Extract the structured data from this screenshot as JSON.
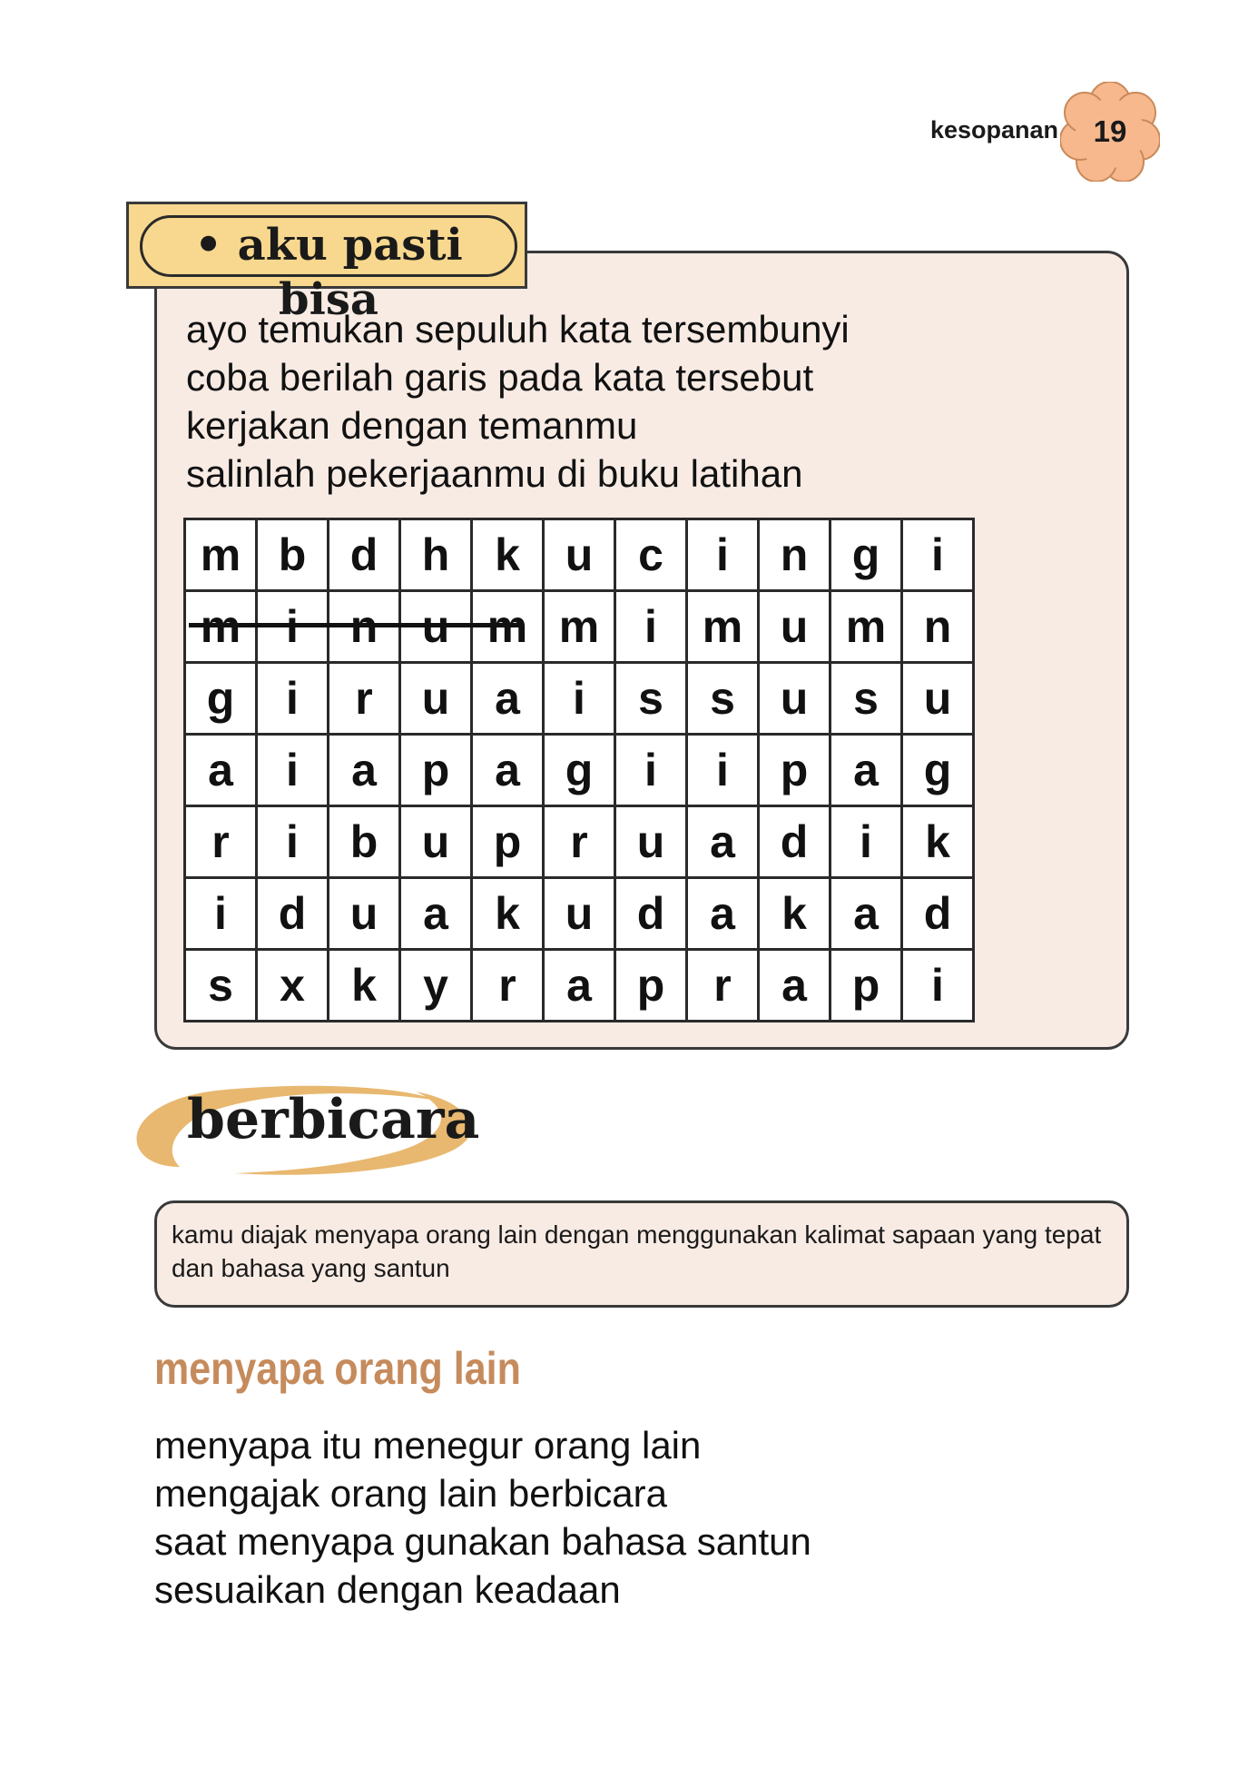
{
  "header": {
    "chapter": "kesopanan",
    "page_number": "19",
    "badge_color": "#f7b88e"
  },
  "activity": {
    "title": "• aku pasti bisa",
    "instructions": [
      "ayo temukan sepuluh kata tersembunyi",
      "coba berilah garis pada kata tersebut",
      "kerjakan dengan temanmu",
      "salinlah pekerjaanmu di buku latihan"
    ],
    "grid": [
      [
        "m",
        "b",
        "d",
        "h",
        "k",
        "u",
        "c",
        "i",
        "n",
        "g",
        "i"
      ],
      [
        "m",
        "i",
        "n",
        "u",
        "m",
        "m",
        "i",
        "m",
        "u",
        "m",
        "n"
      ],
      [
        "g",
        "i",
        "r",
        "u",
        "a",
        "i",
        "s",
        "s",
        "u",
        "s",
        "u"
      ],
      [
        "a",
        "i",
        "a",
        "p",
        "a",
        "g",
        "i",
        "i",
        "p",
        "a",
        "g"
      ],
      [
        "r",
        "i",
        "b",
        "u",
        "p",
        "r",
        "u",
        "a",
        "d",
        "i",
        "k"
      ],
      [
        "i",
        "d",
        "u",
        "a",
        "k",
        "u",
        "d",
        "a",
        "k",
        "a",
        "d"
      ],
      [
        "s",
        "x",
        "k",
        "y",
        "r",
        "a",
        "p",
        "r",
        "a",
        "p",
        "i"
      ]
    ],
    "tab_color": "#f8d88e",
    "box_color": "#f8ebe4"
  },
  "section": {
    "title": "berbicara",
    "banner_color": "#e8b870",
    "note": "kamu diajak menyapa orang lain dengan menggunakan kalimat sapaan yang tepat dan bahasa yang santun",
    "subheading": "menyapa orang lain",
    "subheading_color": "#c68b5c",
    "body": [
      "menyapa itu menegur orang lain",
      "mengajak orang lain berbicara",
      "saat menyapa gunakan bahasa santun",
      "sesuaikan dengan keadaan"
    ]
  }
}
